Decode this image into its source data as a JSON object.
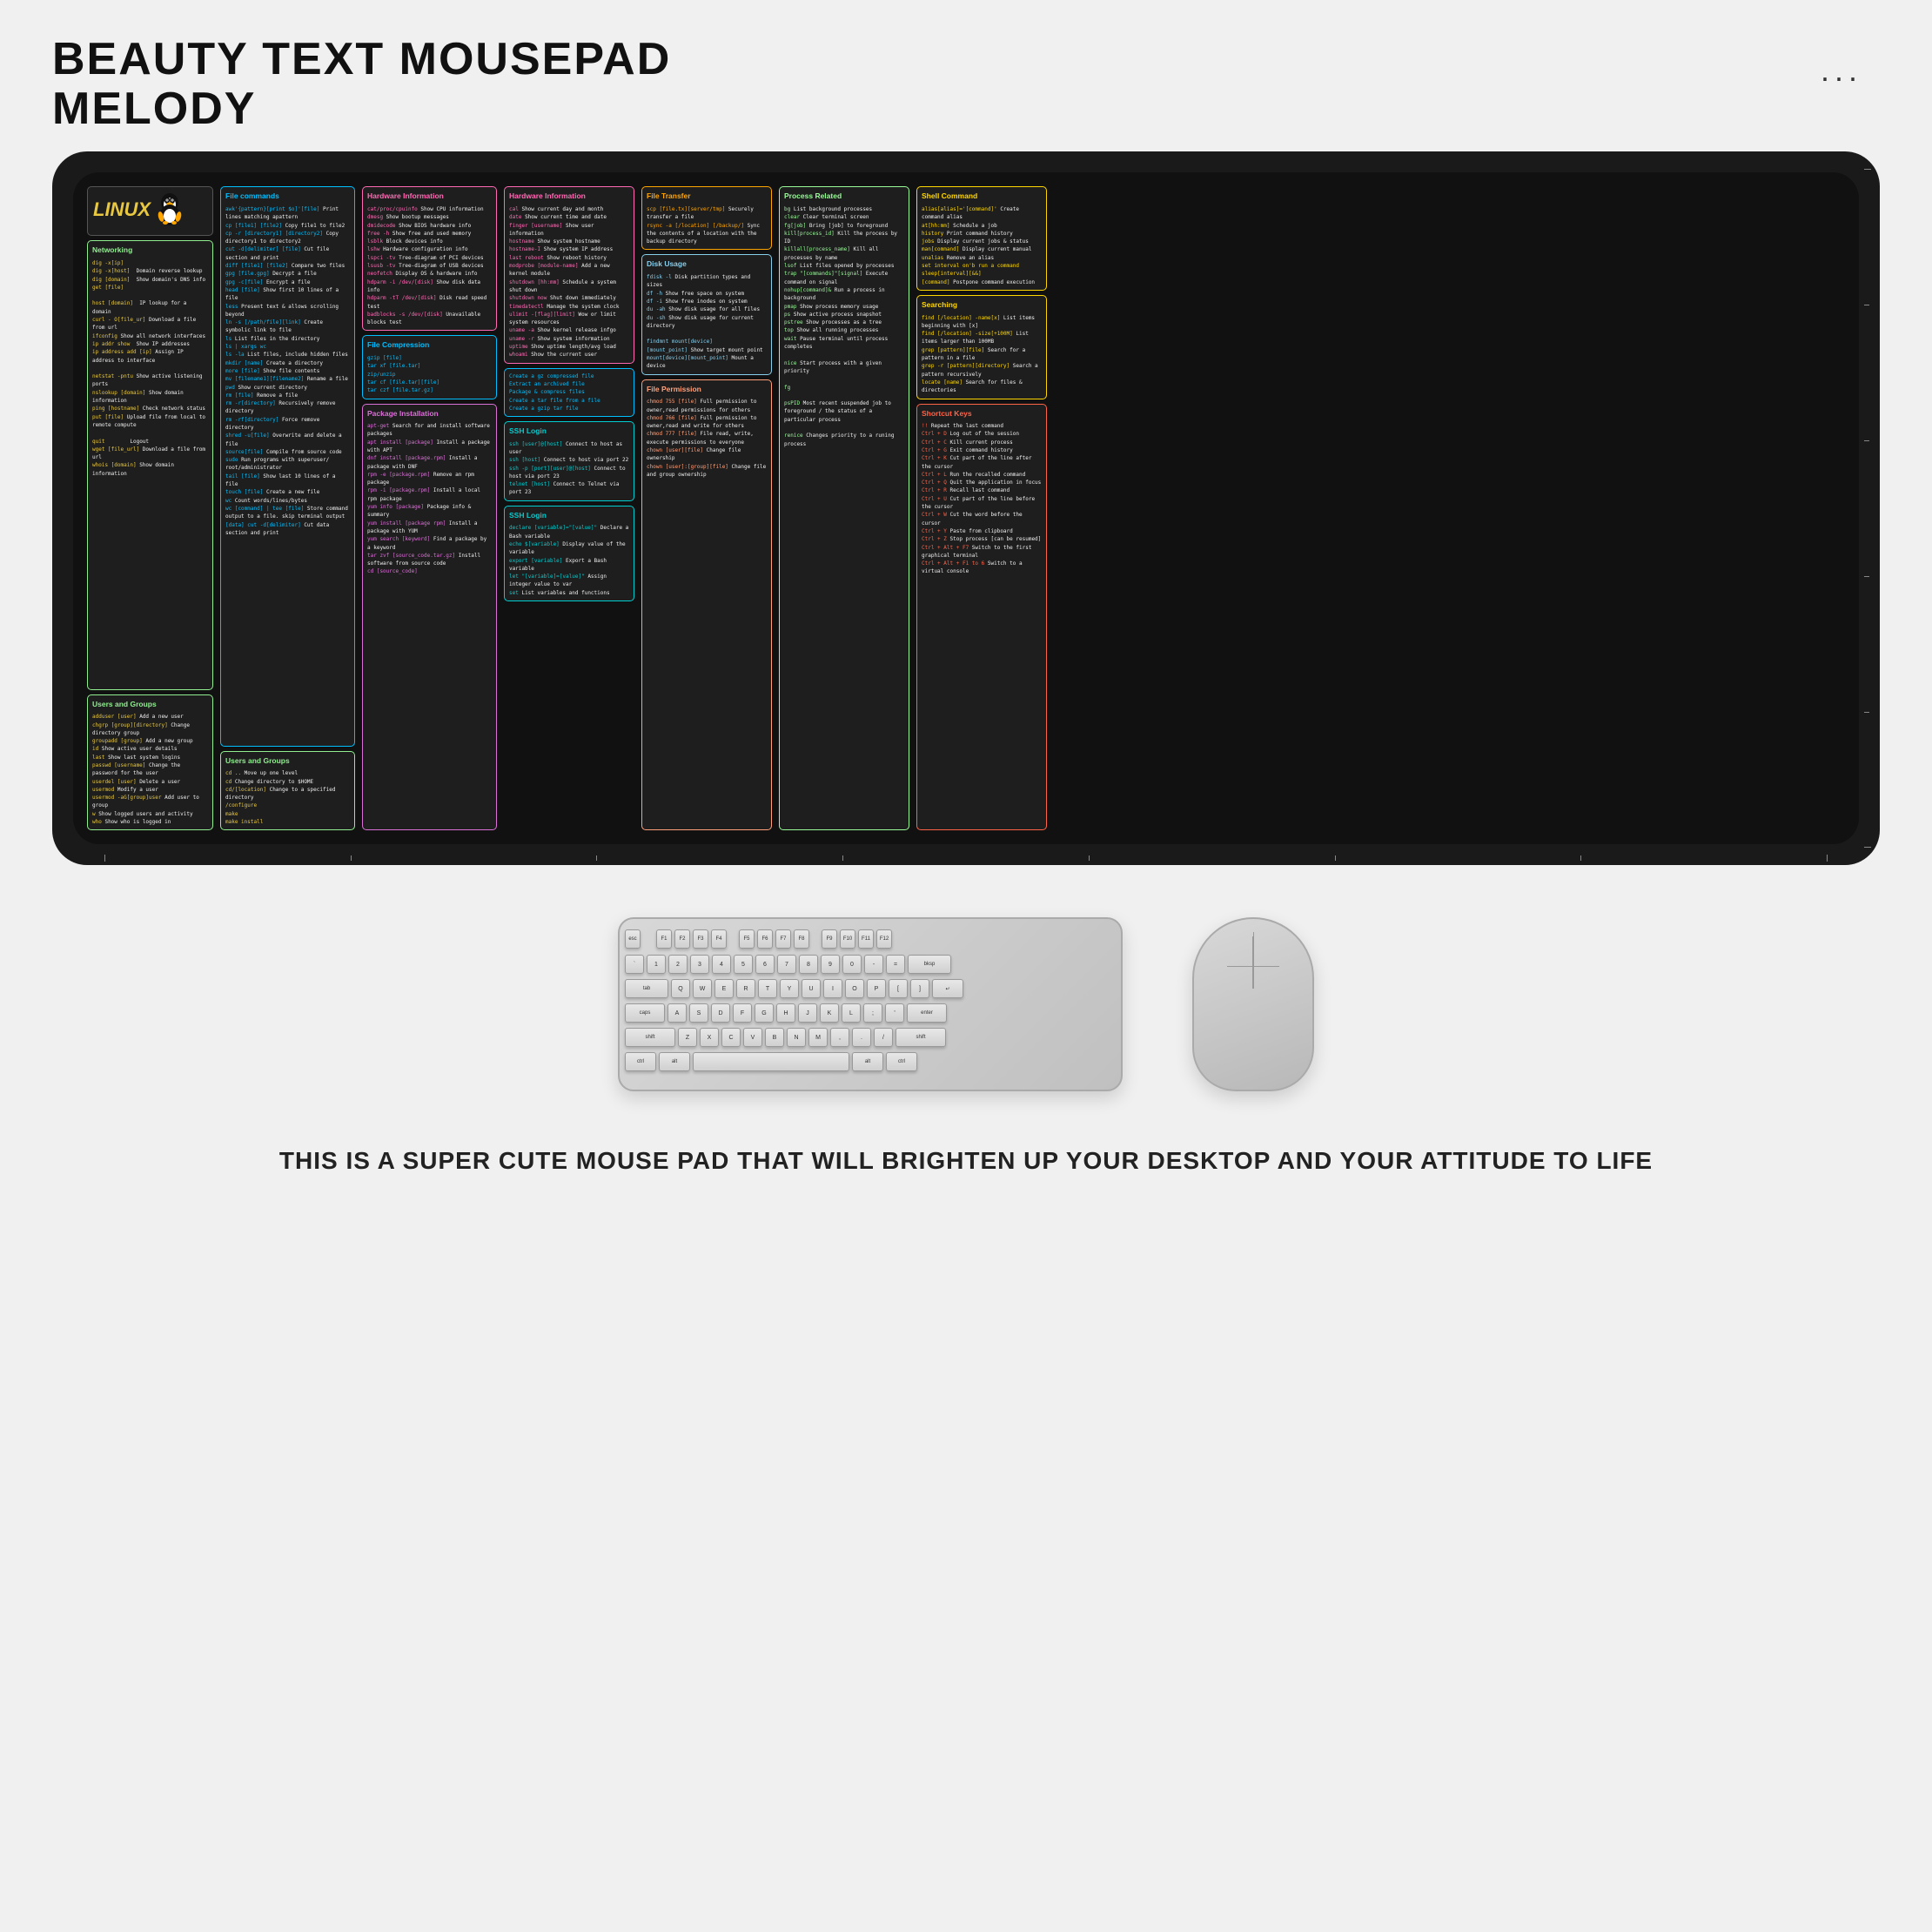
{
  "header": {
    "title_line1": "BEAUTY TEXT MOUSEPAD",
    "title_line2": "MELODY",
    "dots": "..."
  },
  "footer": {
    "text": "THIS IS A SUPER CUTE MOUSE PAD THAT WILL BRIGHTEN UP\nYOUR DESKTOP AND YOUR ATTITUDE TO LIFE"
  },
  "sections": {
    "linux": "LINUX",
    "networking": "Networking",
    "users_and_groups": "Users and Groups",
    "file_commands": "File commands",
    "hardware_info": "Hardware Information",
    "hardware_info2": "Hardware Information",
    "file_transfer": "File Transfer",
    "disk_usage": "Disk Usage",
    "process_related": "Process Related",
    "shell_command": "Shell Command",
    "file_compress": "File Compression",
    "package_install": "Package Installation",
    "ssh_login": "SSH Login",
    "file_permission": "File Permission",
    "searching": "Searching",
    "shortcut_keys": "Shortcut Keys",
    "users_groups2": "Users and Groups"
  }
}
